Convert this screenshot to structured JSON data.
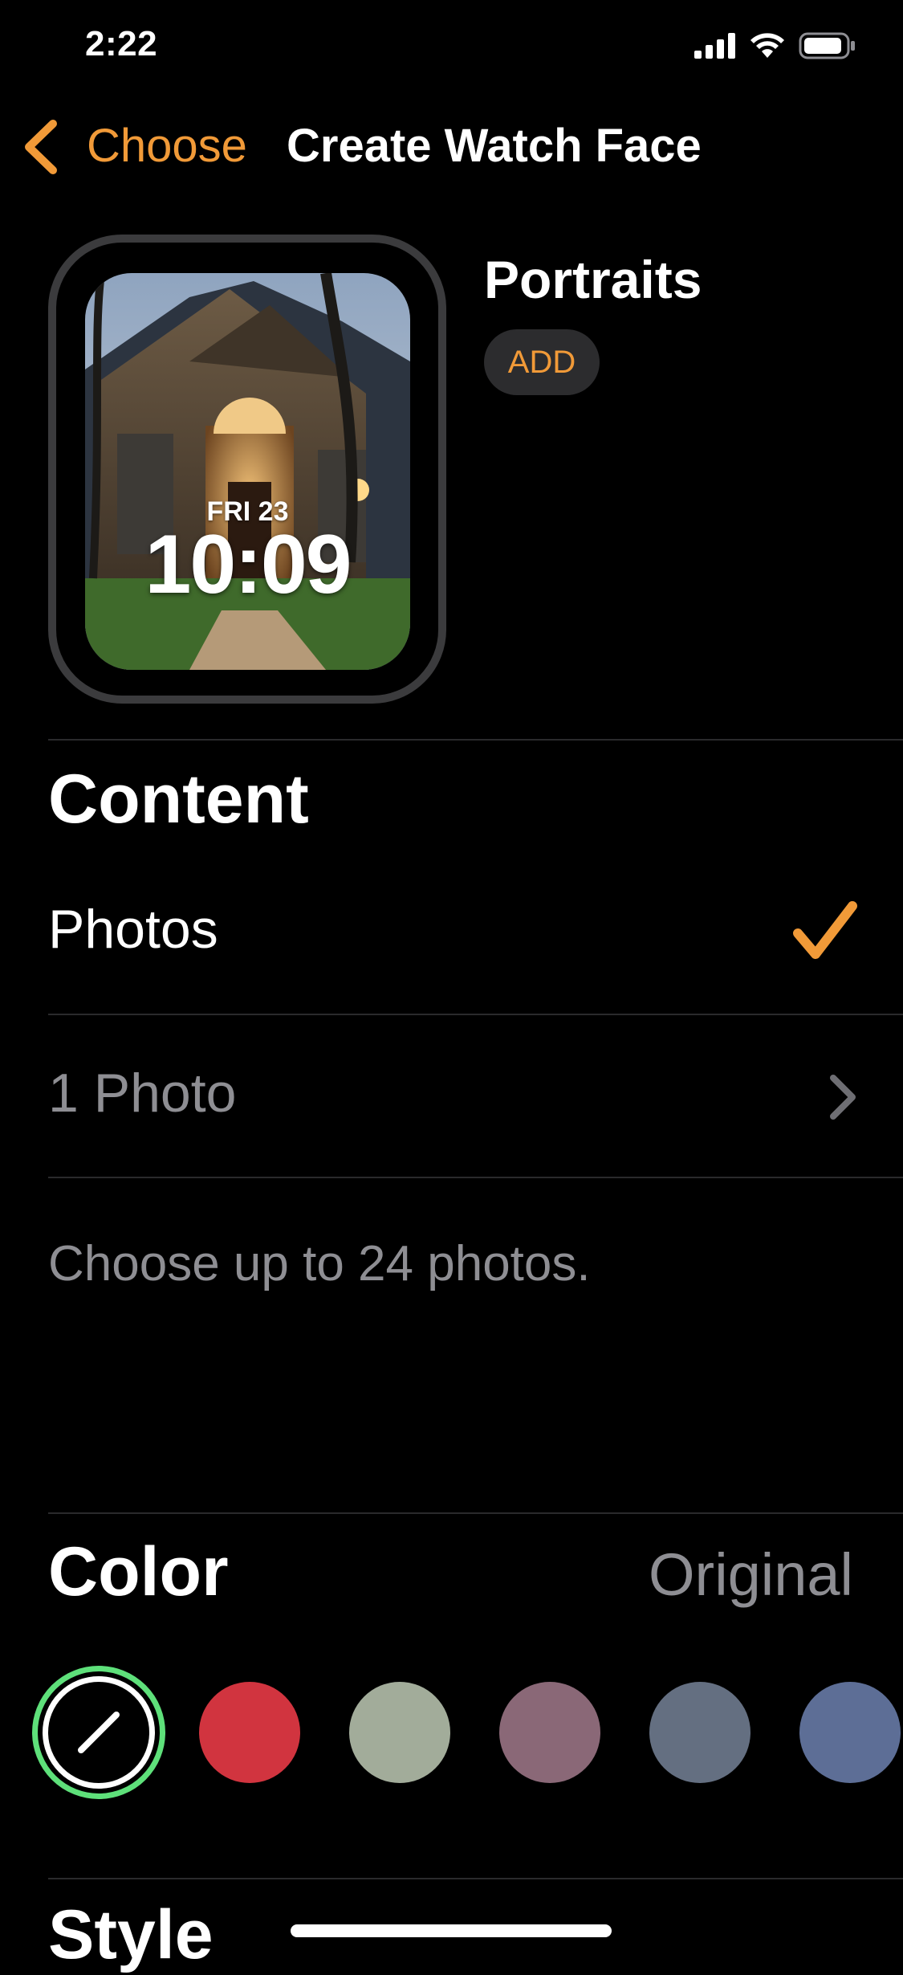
{
  "status_bar": {
    "time": "2:22"
  },
  "nav": {
    "back_label": "Choose",
    "title": "Create Watch Face"
  },
  "watch_preview": {
    "date": "FRI 23",
    "time": "10:09"
  },
  "face": {
    "name": "Portraits",
    "add_label": "ADD"
  },
  "content": {
    "heading": "Content",
    "photos_label": "Photos",
    "photo_count_label": "1 Photo",
    "footnote": "Choose up to 24 photos."
  },
  "color": {
    "heading": "Color",
    "value": "Original",
    "swatches": [
      "#d1343f",
      "#a2ac9a",
      "#8a6877",
      "#646f81",
      "#5d6e96"
    ],
    "selected_ring": "#5ee07a"
  },
  "style": {
    "heading": "Style"
  },
  "accent": "#f19a38"
}
